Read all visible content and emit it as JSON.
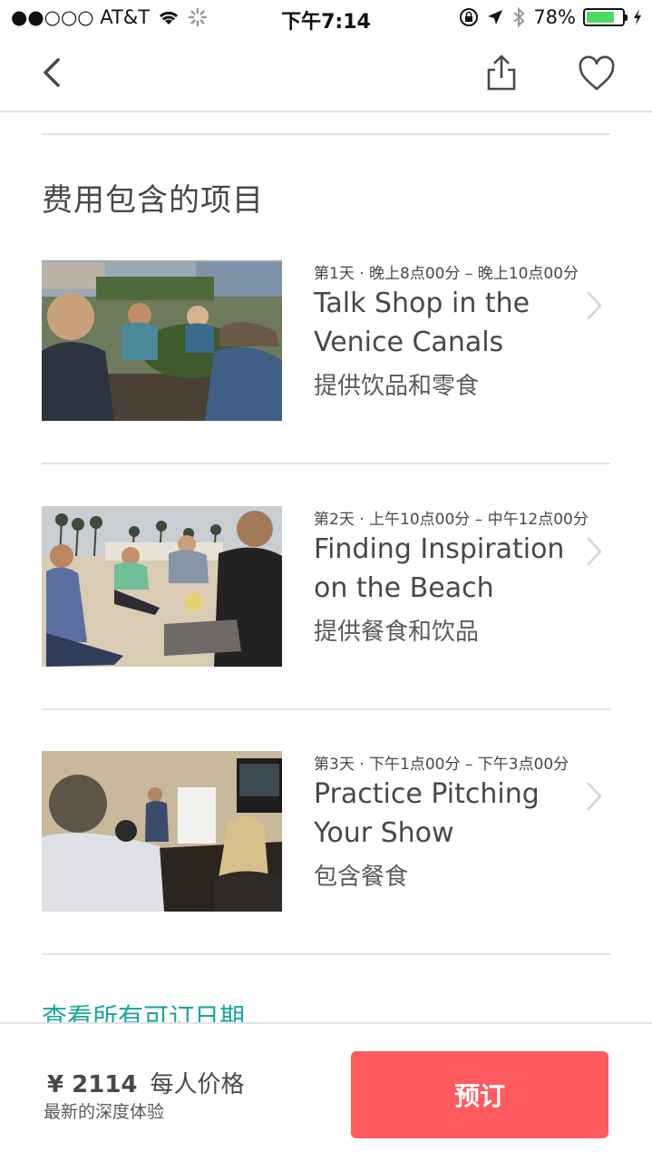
{
  "status_bar": {
    "carrier": "●●○○○ AT&T",
    "time": "下午7:14",
    "battery": "78%",
    "battery_level": 0.78
  },
  "nav": {
    "back_icon": "chevron-left-icon",
    "share_icon": "share-icon",
    "heart_icon": "heart-icon"
  },
  "section": {
    "title": "费用包含的项目"
  },
  "items": [
    {
      "time": "第1天 · 晚上8点00分 – 晚上10点00分",
      "title": "Talk Shop in the Venice Canals",
      "note": "提供饮品和零食"
    },
    {
      "time": "第2天 · 上午10点00分 – 中午12点00分",
      "title": "Finding Inspiration on the Beach",
      "note": "提供餐食和饮品"
    },
    {
      "time": "第3天 · 下午1点00分 – 下午3点00分",
      "title": "Practice Pitching Your Show",
      "note": "包含餐食"
    }
  ],
  "see_all_dates": "查看所有可订日期",
  "booking": {
    "price": "¥ 2114",
    "price_unit": "每人价格",
    "subtitle": "最新的深度体验",
    "button_label": "预订"
  },
  "colors": {
    "accent_teal": "#19a79a",
    "book_button": "#ff5a5f",
    "battery_green": "#4cd964"
  }
}
